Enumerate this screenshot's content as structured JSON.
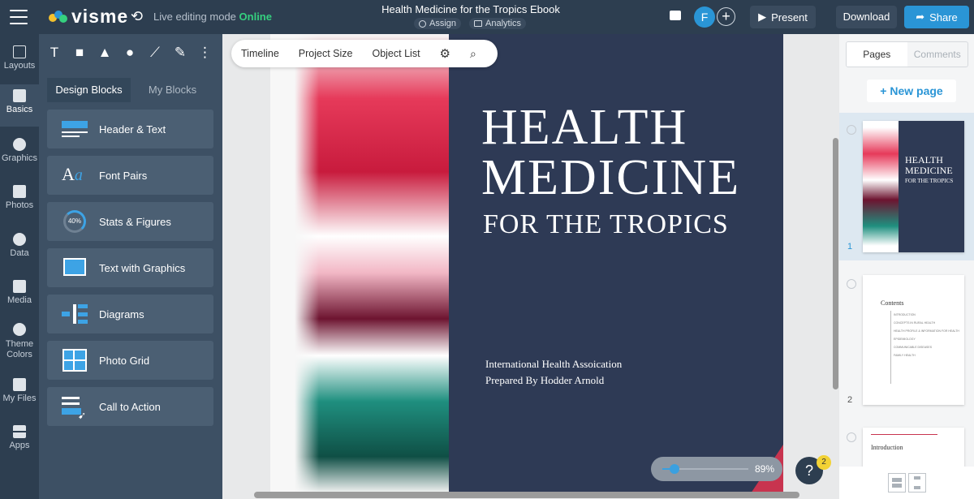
{
  "header": {
    "app_name": "visme",
    "live_label": "Live editing mode",
    "live_status": "Online",
    "doc_title": "Health Medicine for the Tropics Ebook",
    "assign_label": "Assign",
    "analytics_label": "Analytics",
    "avatar_initial": "F",
    "present_label": "Present",
    "download_label": "Download",
    "share_label": "Share",
    "accent": "#2a95d6"
  },
  "rail": {
    "items": [
      {
        "label": "Layouts"
      },
      {
        "label": "Basics"
      },
      {
        "label": "Graphics"
      },
      {
        "label": "Photos"
      },
      {
        "label": "Data"
      },
      {
        "label": "Media"
      },
      {
        "label": "Theme Colors"
      },
      {
        "label": "My Files"
      },
      {
        "label": "Apps"
      }
    ]
  },
  "panel": {
    "tabs": [
      "Design Blocks",
      "My Blocks"
    ],
    "blocks": [
      {
        "label": "Header & Text"
      },
      {
        "label": "Font Pairs"
      },
      {
        "label": "Stats & Figures",
        "badge": "40%"
      },
      {
        "label": "Text with Graphics"
      },
      {
        "label": "Diagrams"
      },
      {
        "label": "Photo Grid"
      },
      {
        "label": "Call to Action"
      }
    ]
  },
  "canvas_toolbar": {
    "timeline": "Timeline",
    "project_size": "Project Size",
    "object_list": "Object List"
  },
  "page": {
    "title_line1": "HEALTH",
    "title_line2": "MEDICINE",
    "title_line3": "FOR THE TROPICS",
    "org": "International Health Assoication",
    "author": "Prepared By Hodder Arnold",
    "bg_color": "#2e3a55"
  },
  "zoom": {
    "value": "89%",
    "fraction": 0.12
  },
  "help": {
    "label": "?",
    "badge": "2"
  },
  "right_panel": {
    "tabs": [
      "Pages",
      "Comments"
    ],
    "new_page": "+ New page",
    "page1": {
      "number": "1",
      "title_a": "HEALTH",
      "title_b": "MEDICINE",
      "title_c": "FOR THE TROPICS"
    },
    "page2": {
      "number": "2",
      "title": "Contents",
      "items": [
        "INTRODUCTION",
        "CONCEPTS IN RURAL HEALTH",
        "HEALTH PROFILE & INFORMATION FOR HEALTH",
        "EPIDEMIOLOGY",
        "COMMUNICABLE DISEASES",
        "FAMILY HEALTH"
      ]
    },
    "page3": {
      "title": "Introduction"
    }
  }
}
